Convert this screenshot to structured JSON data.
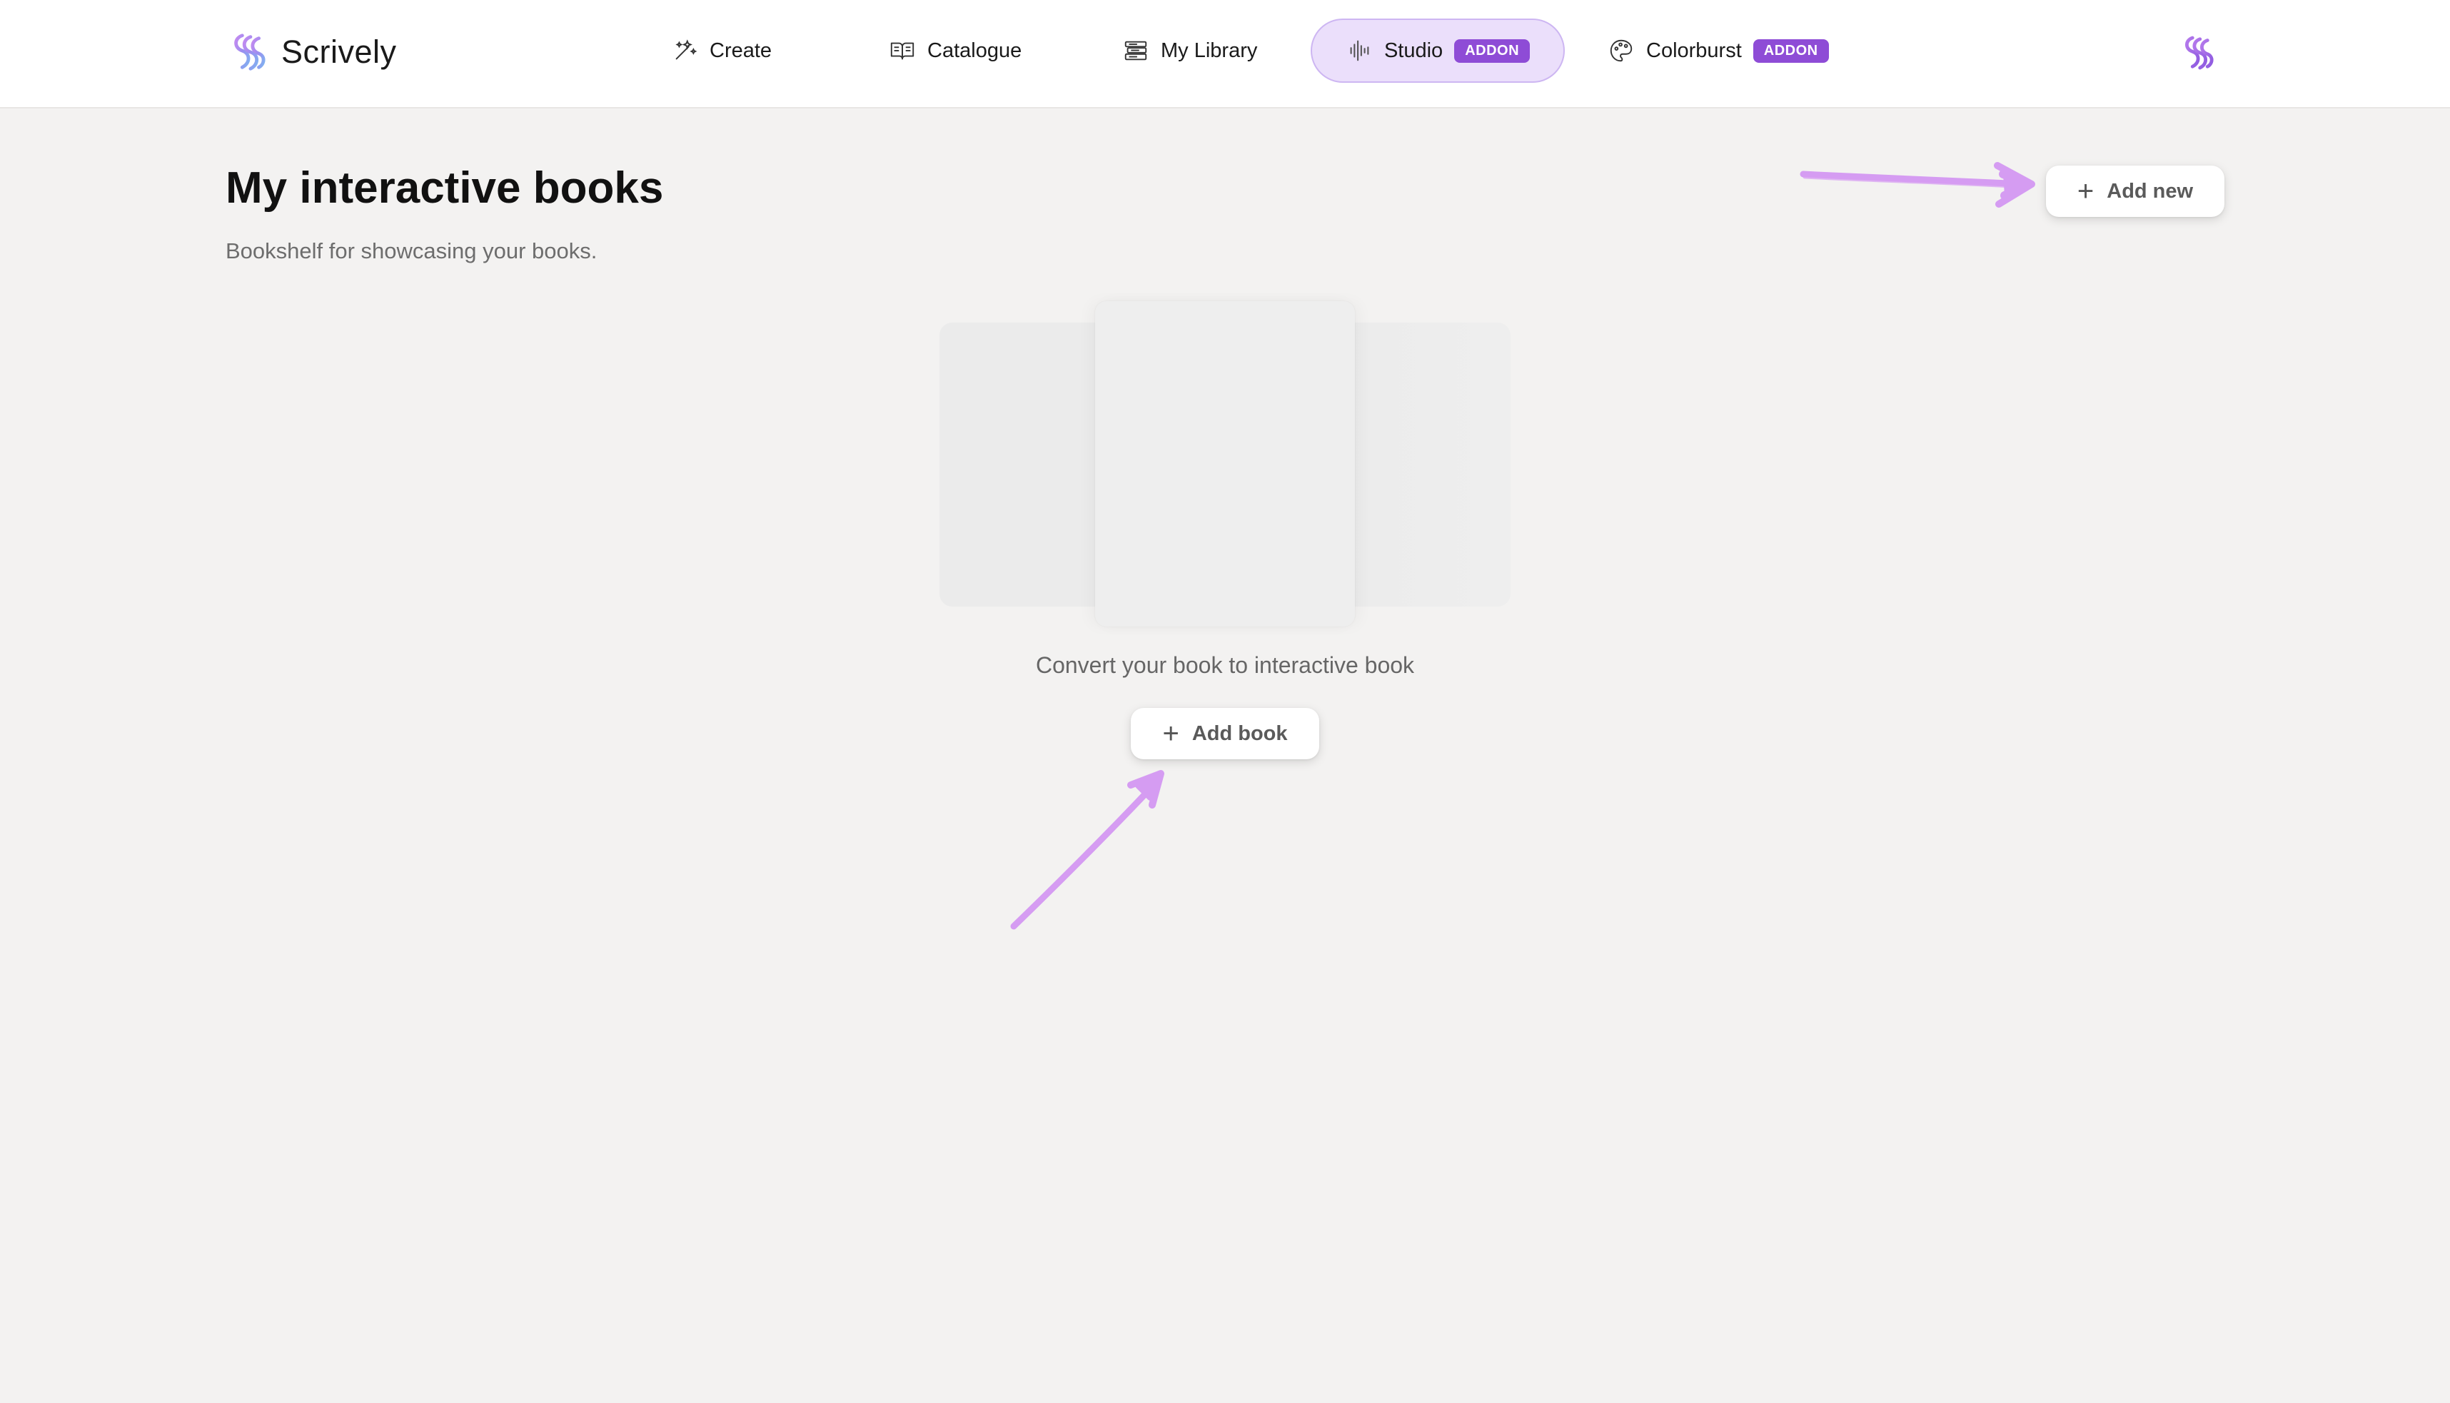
{
  "app": {
    "name": "Scrively"
  },
  "nav": {
    "items": [
      {
        "label": "Create",
        "icon": "magic-wand-icon"
      },
      {
        "label": "Catalogue",
        "icon": "open-book-icon"
      },
      {
        "label": "My Library",
        "icon": "books-stack-icon"
      },
      {
        "label": "Studio",
        "icon": "audio-waveform-icon",
        "badge": "ADDON",
        "active": true
      },
      {
        "label": "Colorburst",
        "icon": "palette-icon",
        "badge": "ADDON"
      }
    ]
  },
  "page": {
    "title": "My interactive books",
    "subtitle": "Bookshelf for showcasing your books.",
    "add_new_label": "Add new"
  },
  "empty_state": {
    "caption": "Convert your book to interactive book",
    "add_book_label": "Add book"
  },
  "colors": {
    "accent": "#8e4cd6",
    "active_nav_bg": "#ebdffb",
    "annotation_arrow": "#d59cf2",
    "background": "#f3f2f1"
  }
}
